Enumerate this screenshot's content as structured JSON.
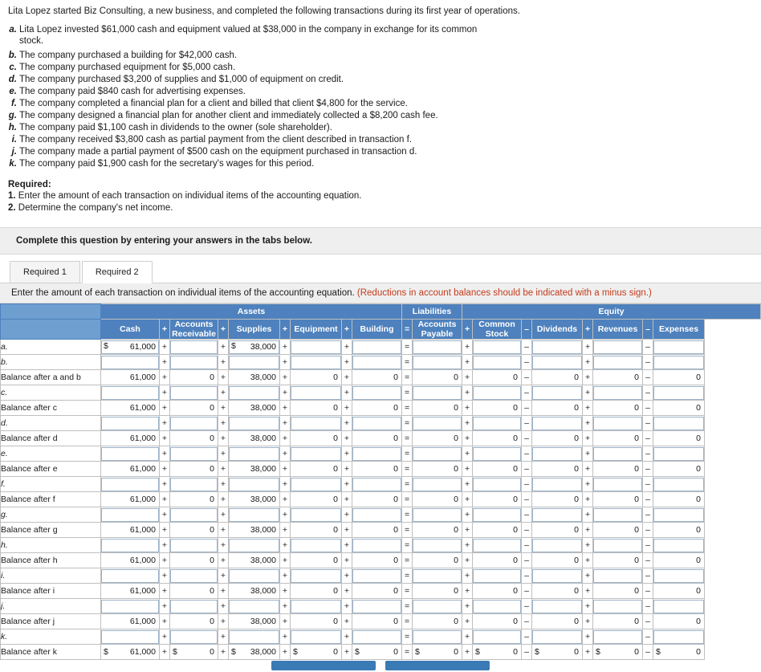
{
  "intro": "Lita Lopez started Biz Consulting, a new business, and completed the following transactions during its first year of operations.",
  "transactions": [
    {
      "letter": "a.",
      "text": "Lita Lopez invested $61,000 cash and equipment valued at $38,000 in the company in exchange for its common stock."
    },
    {
      "letter": "b.",
      "text": "The company purchased a building for $42,000 cash."
    },
    {
      "letter": "c.",
      "text": "The company purchased equipment for $5,000 cash."
    },
    {
      "letter": "d.",
      "text": "The company purchased $3,200 of supplies and $1,000 of equipment on credit."
    },
    {
      "letter": "e.",
      "text": "The company paid $840 cash for advertising expenses."
    },
    {
      "letter": "f.",
      "text": "The company completed a financial plan for a client and billed that client $4,800 for the service."
    },
    {
      "letter": "g.",
      "text": "The company designed a financial plan for another client and immediately collected a $8,200 cash fee."
    },
    {
      "letter": "h.",
      "text": "The company paid $1,100 cash in dividends to the owner (sole shareholder)."
    },
    {
      "letter": "i.",
      "text": "The company received $3,800 cash as partial payment from the client described in transaction f."
    },
    {
      "letter": "j.",
      "text": "The company made a partial payment of $500 cash on the equipment purchased in transaction d."
    },
    {
      "letter": "k.",
      "text": "The company paid $1,900 cash for the secretary's wages for this period."
    }
  ],
  "required": {
    "title": "Required:",
    "items": [
      {
        "num": "1.",
        "text": "Enter the amount of each transaction on individual items of the accounting equation."
      },
      {
        "num": "2.",
        "text": "Determine the company's net income."
      }
    ]
  },
  "complete_bar": "Complete this question by entering your answers in the tabs below.",
  "tabs": [
    {
      "label": "Required 1",
      "active": false
    },
    {
      "label": "Required 2",
      "active": true
    }
  ],
  "instruction": {
    "main": "Enter the amount of each transaction on individual items of the accounting equation.",
    "hint": "(Reductions in account balances should be indicated with a minus sign.)"
  },
  "table": {
    "groups": [
      {
        "label": "Assets",
        "span": 9
      },
      {
        "label": "Liabilities",
        "span": 2
      },
      {
        "label": "Equity",
        "span": 9
      }
    ],
    "columns": [
      "Cash",
      "Accounts Receivable",
      "Supplies",
      "Equipment",
      "Building",
      "Accounts Payable",
      "Common Stock",
      "Dividends",
      "Revenues",
      "Expenses"
    ],
    "operators": [
      "+",
      "+",
      "+",
      "+",
      "=",
      "+",
      "–",
      "+",
      "–"
    ],
    "rows": [
      {
        "label": "a.",
        "type": "entry",
        "cash": "61,000",
        "cash_dollar": true,
        "ar": "",
        "sup": "38,000",
        "sup_dollar": true,
        "eq": "",
        "bld": "",
        "ap": "",
        "cs": "",
        "div": "",
        "rev": "",
        "exp": ""
      },
      {
        "label": "b.",
        "type": "entry",
        "cash": "",
        "ar": "",
        "sup": "",
        "eq": "",
        "bld": "",
        "ap": "",
        "cs": "",
        "div": "",
        "rev": "",
        "exp": ""
      },
      {
        "label": "Balance after a and b",
        "type": "balance",
        "cash": "61,000",
        "ar": "0",
        "sup": "38,000",
        "eq": "0",
        "bld": "0",
        "ap": "0",
        "cs": "0",
        "div": "0",
        "rev": "0",
        "exp": "0"
      },
      {
        "label": "c.",
        "type": "entry",
        "cash": "",
        "ar": "",
        "sup": "",
        "eq": "",
        "bld": "",
        "ap": "",
        "cs": "",
        "div": "",
        "rev": "",
        "exp": ""
      },
      {
        "label": "Balance after c",
        "type": "balance",
        "cash": "61,000",
        "ar": "0",
        "sup": "38,000",
        "eq": "0",
        "bld": "0",
        "ap": "0",
        "cs": "0",
        "div": "0",
        "rev": "0",
        "exp": "0"
      },
      {
        "label": "d.",
        "type": "entry",
        "cash": "",
        "ar": "",
        "sup": "",
        "eq": "",
        "bld": "",
        "ap": "",
        "cs": "",
        "div": "",
        "rev": "",
        "exp": ""
      },
      {
        "label": "Balance after d",
        "type": "balance",
        "cash": "61,000",
        "ar": "0",
        "sup": "38,000",
        "eq": "0",
        "bld": "0",
        "ap": "0",
        "cs": "0",
        "div": "0",
        "rev": "0",
        "exp": "0"
      },
      {
        "label": "e.",
        "type": "entry",
        "cash": "",
        "ar": "",
        "sup": "",
        "eq": "",
        "bld": "",
        "ap": "",
        "cs": "",
        "div": "",
        "rev": "",
        "exp": ""
      },
      {
        "label": "Balance after e",
        "type": "balance",
        "cash": "61,000",
        "ar": "0",
        "sup": "38,000",
        "eq": "0",
        "bld": "0",
        "ap": "0",
        "cs": "0",
        "div": "0",
        "rev": "0",
        "exp": "0"
      },
      {
        "label": "f.",
        "type": "entry",
        "cash": "",
        "ar": "",
        "sup": "",
        "eq": "",
        "bld": "",
        "ap": "",
        "cs": "",
        "div": "",
        "rev": "",
        "exp": ""
      },
      {
        "label": "Balance after f",
        "type": "balance",
        "cash": "61,000",
        "ar": "0",
        "sup": "38,000",
        "eq": "0",
        "bld": "0",
        "ap": "0",
        "cs": "0",
        "div": "0",
        "rev": "0",
        "exp": "0"
      },
      {
        "label": "g.",
        "type": "entry",
        "cash": "",
        "ar": "",
        "sup": "",
        "eq": "",
        "bld": "",
        "ap": "",
        "cs": "",
        "div": "",
        "rev": "",
        "exp": ""
      },
      {
        "label": "Balance after g",
        "type": "balance",
        "cash": "61,000",
        "ar": "0",
        "sup": "38,000",
        "eq": "0",
        "bld": "0",
        "ap": "0",
        "cs": "0",
        "div": "0",
        "rev": "0",
        "exp": "0"
      },
      {
        "label": "h.",
        "type": "entry",
        "cash": "",
        "ar": "",
        "sup": "",
        "eq": "",
        "bld": "",
        "ap": "",
        "cs": "",
        "div": "",
        "rev": "",
        "exp": ""
      },
      {
        "label": "Balance after h",
        "type": "balance",
        "cash": "61,000",
        "ar": "0",
        "sup": "38,000",
        "eq": "0",
        "bld": "0",
        "ap": "0",
        "cs": "0",
        "div": "0",
        "rev": "0",
        "exp": "0"
      },
      {
        "label": "i.",
        "type": "entry",
        "cash": "",
        "ar": "",
        "sup": "",
        "eq": "",
        "bld": "",
        "ap": "",
        "cs": "",
        "div": "",
        "rev": "",
        "exp": ""
      },
      {
        "label": "Balance after i",
        "type": "balance",
        "cash": "61,000",
        "ar": "0",
        "sup": "38,000",
        "eq": "0",
        "bld": "0",
        "ap": "0",
        "cs": "0",
        "div": "0",
        "rev": "0",
        "exp": "0"
      },
      {
        "label": "j.",
        "type": "entry",
        "cash": "",
        "ar": "",
        "sup": "",
        "eq": "",
        "bld": "",
        "ap": "",
        "cs": "",
        "div": "",
        "rev": "",
        "exp": ""
      },
      {
        "label": "Balance after j",
        "type": "balance",
        "cash": "61,000",
        "ar": "0",
        "sup": "38,000",
        "eq": "0",
        "bld": "0",
        "ap": "0",
        "cs": "0",
        "div": "0",
        "rev": "0",
        "exp": "0"
      },
      {
        "label": "k.",
        "type": "entry",
        "cash": "",
        "ar": "",
        "sup": "",
        "eq": "",
        "bld": "",
        "ap": "",
        "cs": "",
        "div": "",
        "rev": "",
        "exp": ""
      },
      {
        "label": "Balance after k",
        "type": "total",
        "cash": "61,000",
        "ar": "0",
        "sup": "38,000",
        "eq": "0",
        "bld": "0",
        "ap": "0",
        "cs": "0",
        "div": "0",
        "rev": "0",
        "exp": "0"
      }
    ]
  },
  "footer_buttons": [
    {
      "label": ""
    },
    {
      "label": ""
    }
  ]
}
